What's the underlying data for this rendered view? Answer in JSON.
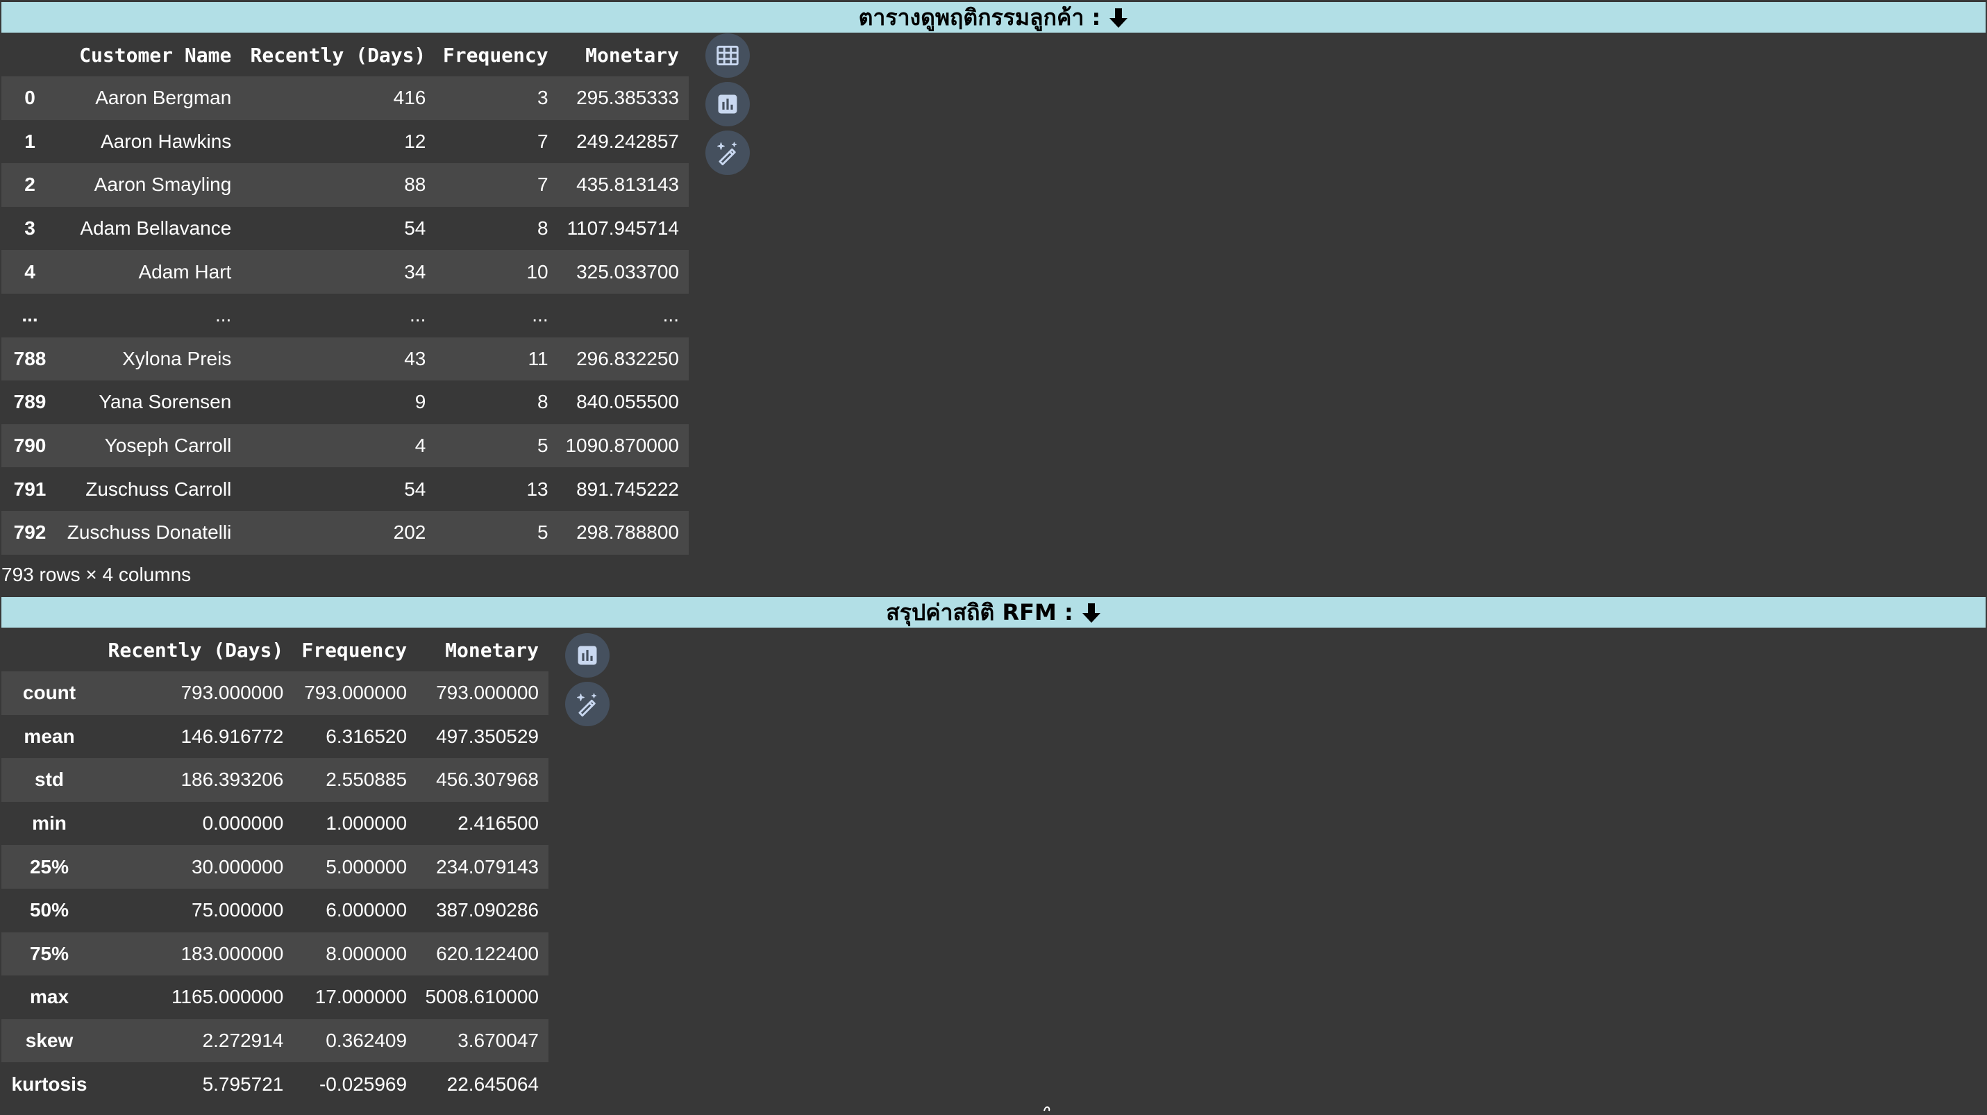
{
  "section1": {
    "title": "ตารางดูพฤติกรรมลูกค้า :",
    "title_icon": "down-arrow-icon",
    "columns": [
      "",
      "Customer Name",
      "Recently (Days)",
      "Frequency",
      "Monetary"
    ],
    "rows": [
      [
        "0",
        "Aaron Bergman",
        "416",
        "3",
        "295.385333"
      ],
      [
        "1",
        "Aaron Hawkins",
        "12",
        "7",
        "249.242857"
      ],
      [
        "2",
        "Aaron Smayling",
        "88",
        "7",
        "435.813143"
      ],
      [
        "3",
        "Adam Bellavance",
        "54",
        "8",
        "1107.945714"
      ],
      [
        "4",
        "Adam Hart",
        "34",
        "10",
        "325.033700"
      ],
      [
        "...",
        "...",
        "...",
        "...",
        "..."
      ],
      [
        "788",
        "Xylona Preis",
        "43",
        "11",
        "296.832250"
      ],
      [
        "789",
        "Yana Sorensen",
        "9",
        "8",
        "840.055500"
      ],
      [
        "790",
        "Yoseph Carroll",
        "4",
        "5",
        "1090.870000"
      ],
      [
        "791",
        "Zuschuss Carroll",
        "54",
        "13",
        "891.745222"
      ],
      [
        "792",
        "Zuschuss Donatelli",
        "202",
        "5",
        "298.788800"
      ]
    ],
    "footer": "793 rows × 4 columns",
    "tools": [
      "table-icon",
      "bar-chart-icon",
      "magic-wand-icon"
    ]
  },
  "section2": {
    "title": "สรุปค่าสถิติ RFM :",
    "title_icon": "down-arrow-icon",
    "columns": [
      "",
      "Recently (Days)",
      "Frequency",
      "Monetary"
    ],
    "rows": [
      [
        "count",
        "793.000000",
        "793.000000",
        "793.000000"
      ],
      [
        "mean",
        "146.916772",
        "6.316520",
        "497.350529"
      ],
      [
        "std",
        "186.393206",
        "2.550885",
        "456.307968"
      ],
      [
        "min",
        "0.000000",
        "1.000000",
        "2.416500"
      ],
      [
        "25%",
        "30.000000",
        "5.000000",
        "234.079143"
      ],
      [
        "50%",
        "75.000000",
        "6.000000",
        "387.090286"
      ],
      [
        "75%",
        "183.000000",
        "8.000000",
        "620.122400"
      ],
      [
        "max",
        "1165.000000",
        "17.000000",
        "5008.610000"
      ],
      [
        "skew",
        "2.272914",
        "0.362409",
        "3.670047"
      ],
      [
        "kurtosis",
        "5.795721",
        "-0.025969",
        "22.645064"
      ]
    ],
    "tools": [
      "bar-chart-icon",
      "magic-wand-icon"
    ]
  },
  "colors": {
    "background": "#383838",
    "row_odd": "#484848",
    "banner": "#b2dfe6",
    "icon_button": "#45505e",
    "icon_stroke": "#c9d8f0"
  }
}
